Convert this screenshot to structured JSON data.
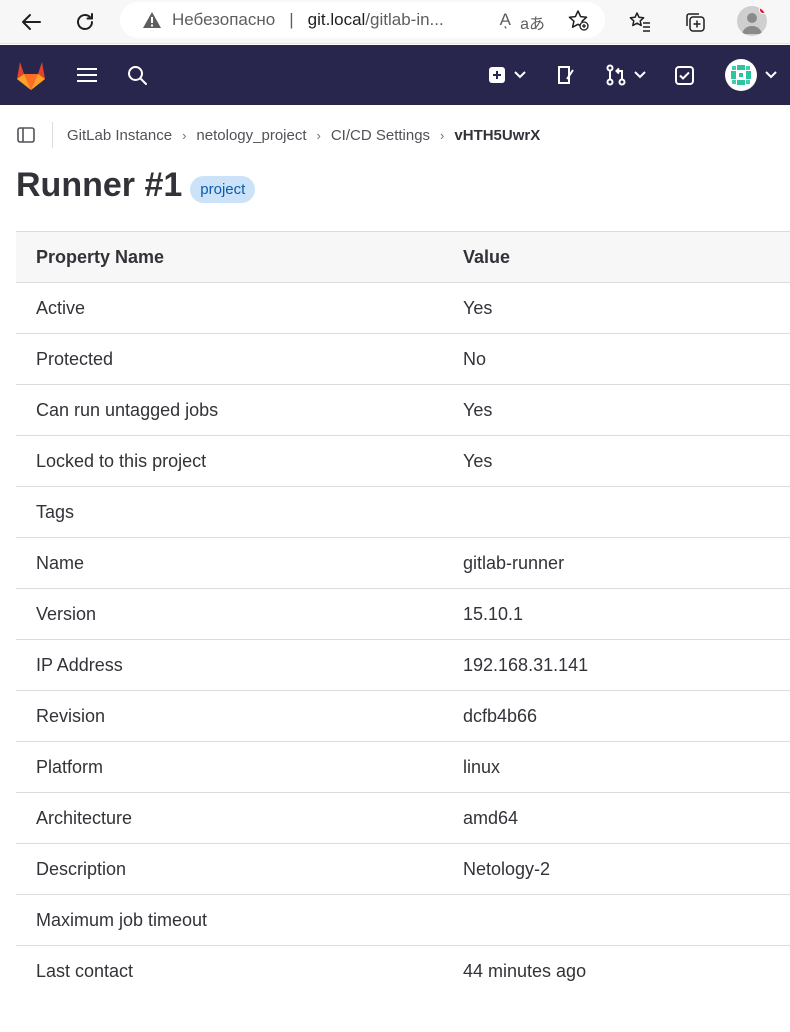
{
  "browser": {
    "insecure_label": "Небезопасно",
    "url_host": "git.local",
    "url_path": "/gitlab-in...",
    "reader_glyph": "Aͅ",
    "translate_glyph": "aあ"
  },
  "breadcrumb": {
    "items": [
      "GitLab Instance",
      "netology_project",
      "CI/CD Settings"
    ],
    "current": "vHTH5UwrX"
  },
  "page": {
    "title": "Runner #1",
    "badge": "project"
  },
  "table": {
    "headers": [
      "Property Name",
      "Value"
    ],
    "rows": [
      [
        "Active",
        "Yes"
      ],
      [
        "Protected",
        "No"
      ],
      [
        "Can run untagged jobs",
        "Yes"
      ],
      [
        "Locked to this project",
        "Yes"
      ],
      [
        "Tags",
        ""
      ],
      [
        "Name",
        "gitlab-runner"
      ],
      [
        "Version",
        "15.10.1"
      ],
      [
        "IP Address",
        "192.168.31.141"
      ],
      [
        "Revision",
        "dcfb4b66"
      ],
      [
        "Platform",
        "linux"
      ],
      [
        "Architecture",
        "amd64"
      ],
      [
        "Description",
        "Netology-2"
      ],
      [
        "Maximum job timeout",
        ""
      ],
      [
        "Last contact",
        "44 minutes ago"
      ]
    ]
  },
  "colors": {
    "nav_bg": "#28264d",
    "badge_bg": "#cbe2f9",
    "badge_text": "#0b5cad",
    "tanuki": "#e24329"
  }
}
